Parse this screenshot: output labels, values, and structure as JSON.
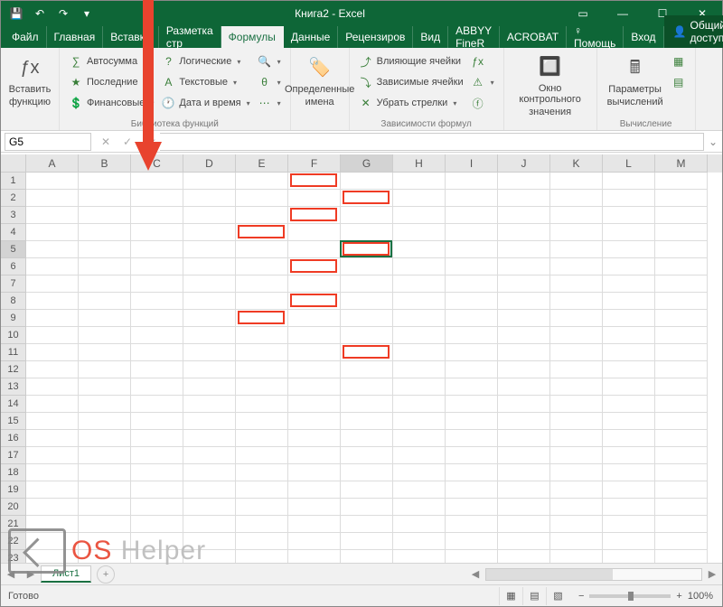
{
  "title": "Книга2 - Excel",
  "qat": {
    "save": "💾",
    "undo": "↶",
    "redo": "↷",
    "custom": "▾"
  },
  "win": {
    "opts": "▭",
    "min": "—",
    "max": "☐",
    "close": "✕"
  },
  "tabs": [
    "Файл",
    "Главная",
    "Вставка",
    "Разметка стр",
    "Формулы",
    "Данные",
    "Рецензиров",
    "Вид",
    "ABBYY FineR",
    "ACROBAT",
    "♀ Помощь",
    "Вход"
  ],
  "active_tab_index": 4,
  "share": "Общий доступ",
  "ribbon": {
    "insert_fn": {
      "icon": "ƒx",
      "l1": "Вставить",
      "l2": "функцию"
    },
    "lib_group": "Библиотека функций",
    "autosum": "Автосумма",
    "recent": "Последние",
    "financial": "Финансовые",
    "logical": "Логические",
    "text": "Текстовые",
    "datetime": "Дата и время",
    "names": {
      "l1": "Определенные",
      "l2": "имена"
    },
    "audit_group": "Зависимости формул",
    "trace_prec": "Влияющие ячейки",
    "trace_dep": "Зависимые ячейки",
    "remove_arrows": "Убрать стрелки",
    "watch": {
      "l1": "Окно контрольного",
      "l2": "значения"
    },
    "calc_group": "Вычисление",
    "calc_opt": {
      "l1": "Параметры",
      "l2": "вычислений"
    }
  },
  "namebox": "G5",
  "cols": [
    "A",
    "B",
    "C",
    "D",
    "E",
    "F",
    "G",
    "H",
    "I",
    "J",
    "K",
    "L",
    "M"
  ],
  "rows_count": 23,
  "active_cell": {
    "col": 6,
    "row": 4
  },
  "redboxes": [
    {
      "col": 5,
      "row": 0,
      "w": 1
    },
    {
      "col": 6,
      "row": 1,
      "w": 1
    },
    {
      "col": 5,
      "row": 2,
      "w": 1
    },
    {
      "col": 4,
      "row": 3,
      "w": 1
    },
    {
      "col": 6,
      "row": 4,
      "w": 1
    },
    {
      "col": 5,
      "row": 5,
      "w": 1
    },
    {
      "col": 5,
      "row": 7,
      "w": 1
    },
    {
      "col": 4,
      "row": 8,
      "w": 1
    },
    {
      "col": 6,
      "row": 10,
      "w": 1
    }
  ],
  "sheet": "Лист1",
  "status": "Готово",
  "zoom": "100%",
  "watermark": {
    "a": "OS",
    "b": "Helper"
  }
}
